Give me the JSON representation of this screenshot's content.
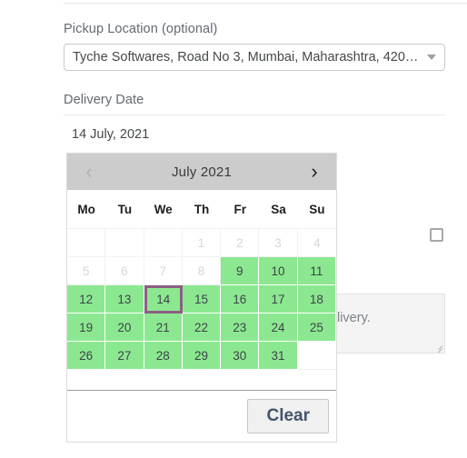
{
  "pickup": {
    "label": "Pickup Location (optional)",
    "selected_value": "Tyche Softwares, Road No 3, Mumbai, Maharashtra, 420…",
    "caret_icon": "chevron-down-icon"
  },
  "delivery": {
    "label": "Delivery Date",
    "value": "14 July, 2021"
  },
  "notes": {
    "placeholder_visible": "r delivery."
  },
  "datepicker": {
    "prev_icon": "chevron-left-icon",
    "next_icon": "chevron-right-icon",
    "month_title": "July 2021",
    "weekdays": [
      "Mo",
      "Tu",
      "We",
      "Th",
      "Fr",
      "Sa",
      "Su"
    ],
    "clear_label": "Clear",
    "colors": {
      "header_bg": "#cccccc",
      "available_bg": "#8ce890",
      "selected_border": "#8a5f83",
      "disabled_text": "#d4d7d9"
    },
    "cells": [
      {
        "day": "",
        "state": "empty"
      },
      {
        "day": "",
        "state": "empty"
      },
      {
        "day": "",
        "state": "empty"
      },
      {
        "day": "1",
        "state": "disabled"
      },
      {
        "day": "2",
        "state": "disabled"
      },
      {
        "day": "3",
        "state": "disabled"
      },
      {
        "day": "4",
        "state": "disabled"
      },
      {
        "day": "5",
        "state": "disabled"
      },
      {
        "day": "6",
        "state": "disabled"
      },
      {
        "day": "7",
        "state": "disabled"
      },
      {
        "day": "8",
        "state": "disabled"
      },
      {
        "day": "9",
        "state": "available"
      },
      {
        "day": "10",
        "state": "available"
      },
      {
        "day": "11",
        "state": "available"
      },
      {
        "day": "12",
        "state": "available"
      },
      {
        "day": "13",
        "state": "available"
      },
      {
        "day": "14",
        "state": "selected"
      },
      {
        "day": "15",
        "state": "available"
      },
      {
        "day": "16",
        "state": "available"
      },
      {
        "day": "17",
        "state": "available"
      },
      {
        "day": "18",
        "state": "available"
      },
      {
        "day": "19",
        "state": "available"
      },
      {
        "day": "20",
        "state": "available"
      },
      {
        "day": "21",
        "state": "available"
      },
      {
        "day": "22",
        "state": "available"
      },
      {
        "day": "23",
        "state": "available"
      },
      {
        "day": "24",
        "state": "available"
      },
      {
        "day": "25",
        "state": "available"
      },
      {
        "day": "26",
        "state": "available"
      },
      {
        "day": "27",
        "state": "available"
      },
      {
        "day": "28",
        "state": "available"
      },
      {
        "day": "29",
        "state": "available"
      },
      {
        "day": "30",
        "state": "available"
      },
      {
        "day": "31",
        "state": "available"
      },
      {
        "day": "",
        "state": "empty"
      }
    ]
  }
}
